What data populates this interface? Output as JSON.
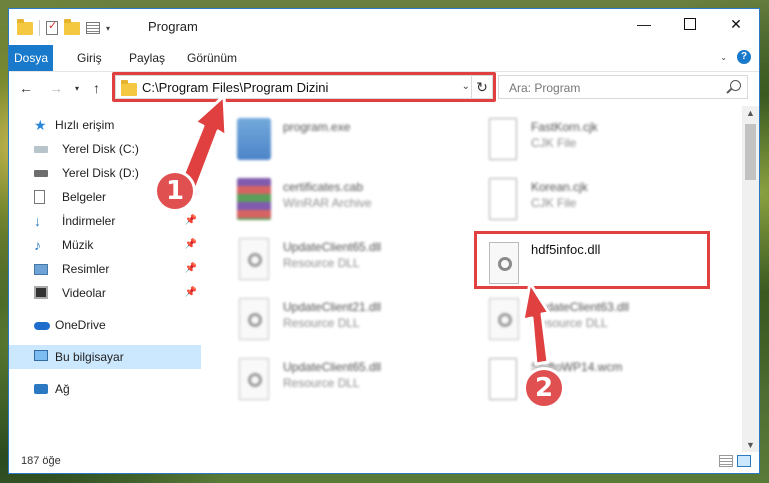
{
  "window": {
    "title": "Program",
    "controls": {
      "minimize": "—",
      "close": "✕"
    }
  },
  "ribbon": {
    "tabs": [
      "Dosya",
      "Giriş",
      "Paylaş",
      "Görünüm"
    ],
    "help": "?"
  },
  "nav": {
    "address": "C:\\Program Files\\Program Dizini",
    "search_placeholder": "Ara: Program"
  },
  "sidebar": {
    "items": [
      {
        "label": "Hızlı erişim",
        "icon": "star-icon"
      },
      {
        "label": "Yerel Disk (C:)",
        "icon": "drive-icon"
      },
      {
        "label": "Yerel Disk (D:)",
        "icon": "drive-icon"
      },
      {
        "label": "Belgeler",
        "icon": "documents-icon"
      },
      {
        "label": "İndirmeler",
        "icon": "download-icon"
      },
      {
        "label": "Müzik",
        "icon": "music-icon"
      },
      {
        "label": "Resimler",
        "icon": "pictures-icon"
      },
      {
        "label": "Videolar",
        "icon": "videos-icon"
      },
      {
        "label": "OneDrive",
        "icon": "cloud-icon"
      },
      {
        "label": "Bu bilgisayar",
        "icon": "computer-icon"
      },
      {
        "label": "Ağ",
        "icon": "network-icon"
      }
    ]
  },
  "files": [
    {
      "name": "program.exe",
      "type": ""
    },
    {
      "name": "FastKorn.cjk",
      "type": "CJK File"
    },
    {
      "name": "certificates.cab",
      "type": "WinRAR Archive"
    },
    {
      "name": "Korean.cjk",
      "type": "CJK File"
    },
    {
      "name": "UpdateClient65.dll",
      "type": "Resource DLL"
    },
    {
      "name": "hdf5infoc.dll",
      "type": ""
    },
    {
      "name": "UpdateClient21.dll",
      "type": "Resource DLL"
    },
    {
      "name": "UpdateClient63.dll",
      "type": "Resource DLL"
    },
    {
      "name": "UpdateClient65.dll",
      "type": "Resource DLL"
    },
    {
      "name": "ShiftoWP14.wcm",
      "type": "File"
    }
  ],
  "status": {
    "count": "187 öğe"
  },
  "annotations": {
    "badge1": "1",
    "badge2": "2",
    "color": "#e04040"
  }
}
